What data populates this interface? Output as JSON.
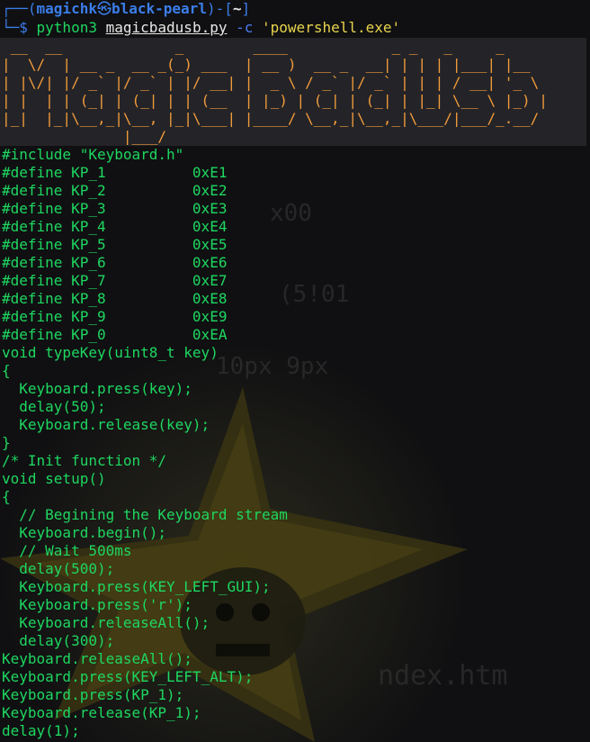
{
  "prompt": {
    "bracket_open": "┌──(",
    "user": "magichk",
    "skull": "㉿",
    "host": "black-pearl",
    "bracket_close": ")-[",
    "dir": "~",
    "dir_close": "]",
    "dollar_prefix": "└─$ ",
    "command": "python3",
    "file": "magicbadusb.py",
    "flag": "-c",
    "arg": "'powershell.exe'"
  },
  "banner": {
    "ascii": " __  __             _        ____            _ _   _     _     \n|  \\/  | __ _  __ _(_) ___  | __ )  __ _  __| | | | |___| |__  \n| |\\/| |/ _` |/ _` | |/ __| |  _ \\ / _` |/ _` | | | / __| '_ \\ \n| |  | | (_| | (_| | | (__  | |_) | (_| | (_| | |_| \\__ \\ |_) |\n|_|  |_|\\__,_|\\__, |_|\\___| |____/ \\__,_|\\__,_|\\___/|___/_.__/ \n              |___/                                            "
  },
  "code_lines": [
    "#include \"Keyboard.h\"",
    "#define KP_1          0xE1",
    "#define KP_2          0xE2",
    "#define KP_3          0xE3",
    "#define KP_4          0xE4",
    "#define KP_5          0xE5",
    "#define KP_6          0xE6",
    "#define KP_7          0xE7",
    "#define KP_8          0xE8",
    "#define KP_9          0xE9",
    "#define KP_0          0xEA",
    "void typeKey(uint8_t key)",
    "{",
    "  Keyboard.press(key);",
    "  delay(50);",
    "  Keyboard.release(key);",
    "}",
    "/* Init function */",
    "void setup()",
    "{",
    "  // Begining the Keyboard stream",
    "  Keyboard.begin();",
    "  // Wait 500ms",
    "  delay(500);",
    "  Keyboard.press(KEY_LEFT_GUI);",
    "  Keyboard.press('r');",
    "  Keyboard.releaseAll();",
    "  delay(300);",
    "Keyboard.releaseAll();",
    "Keyboard.press(KEY_LEFT_ALT);",
    "Keyboard.press(KP_1);",
    "Keyboard.release(KP_1);",
    "delay(1);"
  ],
  "colors": {
    "background": "#101012",
    "prompt": "#3b7de9",
    "code": "#1ed760",
    "banner": "#f29b3a",
    "string_arg": "#e8d44d"
  },
  "icons": {
    "background": "wallpaper-star-skull-icon"
  }
}
